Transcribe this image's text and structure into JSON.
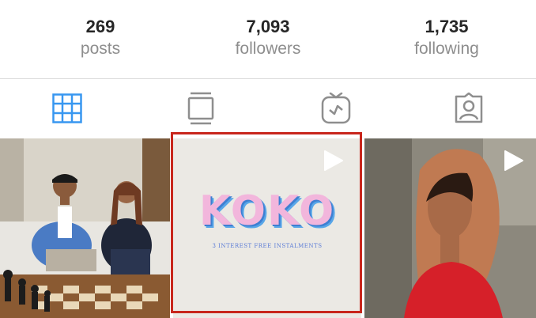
{
  "stats": {
    "posts": {
      "count": "269",
      "label": "posts"
    },
    "followers": {
      "count": "7,093",
      "label": "followers"
    },
    "following": {
      "count": "1,735",
      "label": "following"
    }
  },
  "tabs": [
    {
      "icon": "grid-icon",
      "active": true
    },
    {
      "icon": "feed-icon",
      "active": false
    },
    {
      "icon": "igtv-icon",
      "active": false
    },
    {
      "icon": "tagged-icon",
      "active": false
    }
  ],
  "posts": [
    {
      "type": "photo"
    },
    {
      "type": "video",
      "title": "KOKO",
      "subtitle": "3 INTEREST FREE INSTALMENTS"
    },
    {
      "type": "video"
    }
  ],
  "colors": {
    "accent": "#3897f0",
    "highlight": "#c8261c",
    "text": "#262626",
    "muted": "#8e8e8e"
  }
}
